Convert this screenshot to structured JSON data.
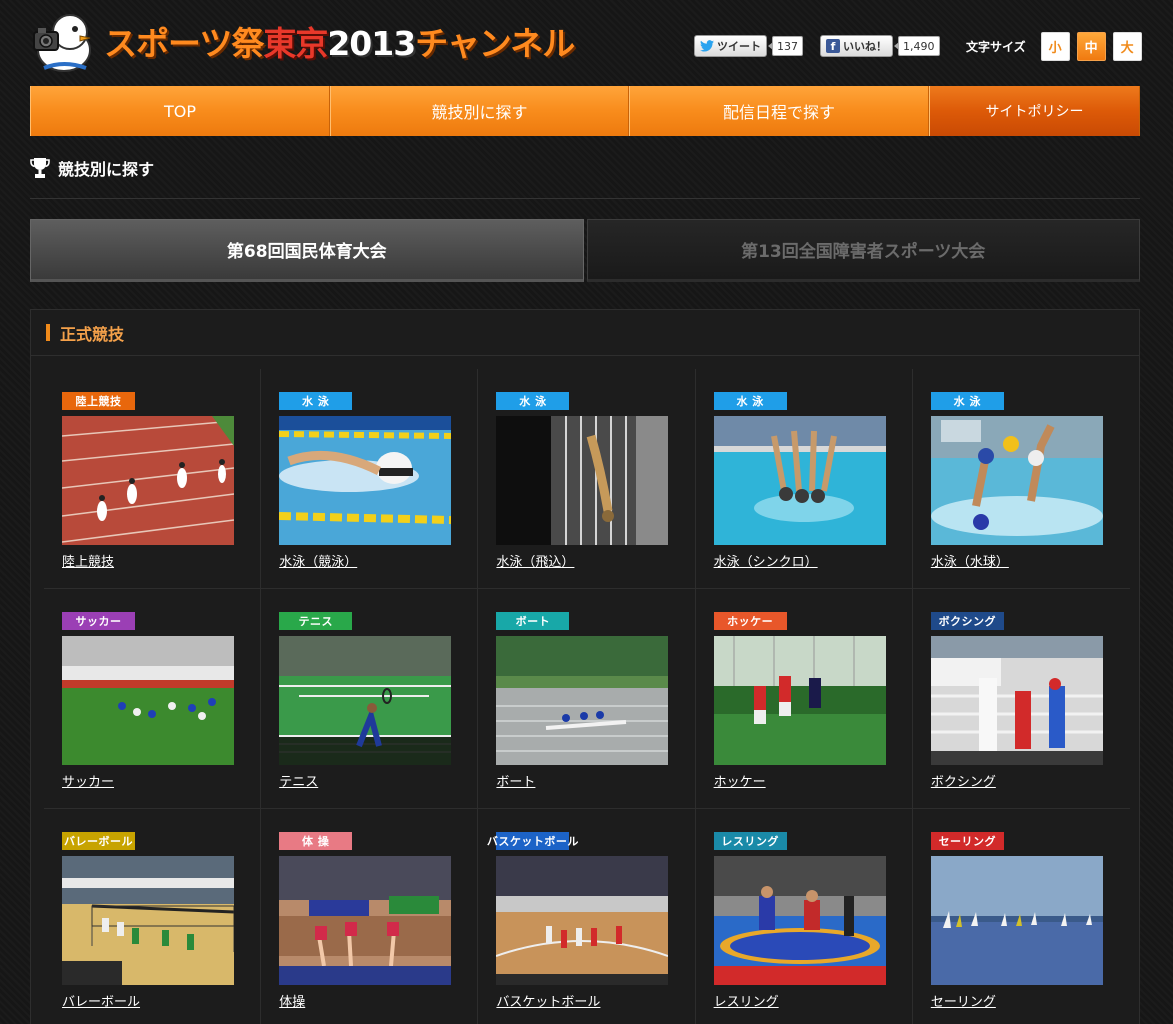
{
  "header": {
    "logo_text_1": "スポーツ祭",
    "logo_text_2": "東京",
    "logo_text_3": "2013",
    "logo_text_4": "チャンネル",
    "tweet_label": "ツイート",
    "tweet_count": "137",
    "like_label": "いいね！",
    "like_count": "1,490",
    "font_size_label": "文字サイズ",
    "font_small": "小",
    "font_medium": "中",
    "font_large": "大"
  },
  "nav": {
    "items": [
      {
        "label": "TOP"
      },
      {
        "label": "競技別に探す"
      },
      {
        "label": "配信日程で探す"
      },
      {
        "label": "サイトポリシー"
      }
    ]
  },
  "page": {
    "title": "競技別に探す"
  },
  "tabs": [
    {
      "label": "第68回国民体育大会",
      "active": true
    },
    {
      "label": "第13回全国障害者スポーツ大会",
      "active": false
    }
  ],
  "section": {
    "title": "正式競技"
  },
  "colors": {
    "accent": "#f08a1a",
    "athletics": "#e8670c",
    "swimming": "#1f9ee8",
    "soccer": "#9b3fb5",
    "tennis": "#29a84a",
    "boat": "#18a8a8",
    "hockey": "#e8572a",
    "boxing": "#1f4a8a",
    "volleyball": "#c7a300",
    "gymnastics": "#e87a84",
    "basketball": "#1c63c7",
    "wrestling": "#1a8aa8",
    "sailing": "#d22a2a"
  },
  "sports": [
    {
      "badge": "陸上競技",
      "label": "陸上競技",
      "color": "#e8670c",
      "photo": "track-photo"
    },
    {
      "badge": "水 泳",
      "label": "水泳（競泳）",
      "color": "#1f9ee8",
      "photo": "swimmer-photo"
    },
    {
      "badge": "水 泳",
      "label": "水泳（飛込）",
      "color": "#1f9ee8",
      "photo": "diver-photo"
    },
    {
      "badge": "水 泳",
      "label": "水泳（シンクロ）",
      "color": "#1f9ee8",
      "photo": "synchro-photo"
    },
    {
      "badge": "水 泳",
      "label": "水泳（水球）",
      "color": "#1f9ee8",
      "photo": "waterpolo-photo"
    },
    {
      "badge": "サッカー",
      "label": "サッカー",
      "color": "#9b3fb5",
      "photo": "soccer-photo"
    },
    {
      "badge": "テニス",
      "label": "テニス",
      "color": "#29a84a",
      "photo": "tennis-photo"
    },
    {
      "badge": "ボート",
      "label": "ボート",
      "color": "#18a8a8",
      "photo": "rowing-photo"
    },
    {
      "badge": "ホッケー",
      "label": "ホッケー",
      "color": "#e8572a",
      "photo": "hockey-photo"
    },
    {
      "badge": "ボクシング",
      "label": "ボクシング",
      "color": "#1f4a8a",
      "photo": "boxing-photo"
    },
    {
      "badge": "バレーボール",
      "label": "バレーボール",
      "color": "#c7a300",
      "photo": "volleyball-photo"
    },
    {
      "badge": "体 操",
      "label": "体操",
      "color": "#e87a84",
      "photo": "gymnastics-photo"
    },
    {
      "badge": "バスケットボール",
      "label": "バスケットボール",
      "color": "#1c63c7",
      "photo": "basketball-photo"
    },
    {
      "badge": "レスリング",
      "label": "レスリング",
      "color": "#1a8aa8",
      "photo": "wrestling-photo"
    },
    {
      "badge": "セーリング",
      "label": "セーリング",
      "color": "#d22a2a",
      "photo": "sailing-photo"
    }
  ]
}
